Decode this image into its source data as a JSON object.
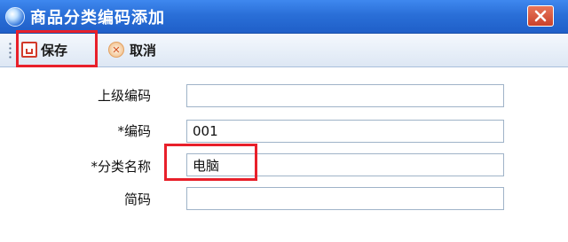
{
  "window": {
    "title": "商品分类编码添加"
  },
  "toolbar": {
    "save_label": "保存",
    "cancel_label": "取消"
  },
  "form": {
    "fields": [
      {
        "label": "上级编码",
        "value": ""
      },
      {
        "label": "*编码",
        "value": "001"
      },
      {
        "label": "*分类名称",
        "value": "电脑"
      },
      {
        "label": "简码",
        "value": ""
      }
    ]
  },
  "colors": {
    "title_bar": "#2a6fd8",
    "highlight": "#e8202a",
    "close_button": "#c9412a"
  },
  "icons": {
    "app": "app-logo-icon",
    "close": "close-icon",
    "save": "save-icon",
    "cancel": "cancel-icon",
    "grip": "toolbar-grip-icon"
  }
}
